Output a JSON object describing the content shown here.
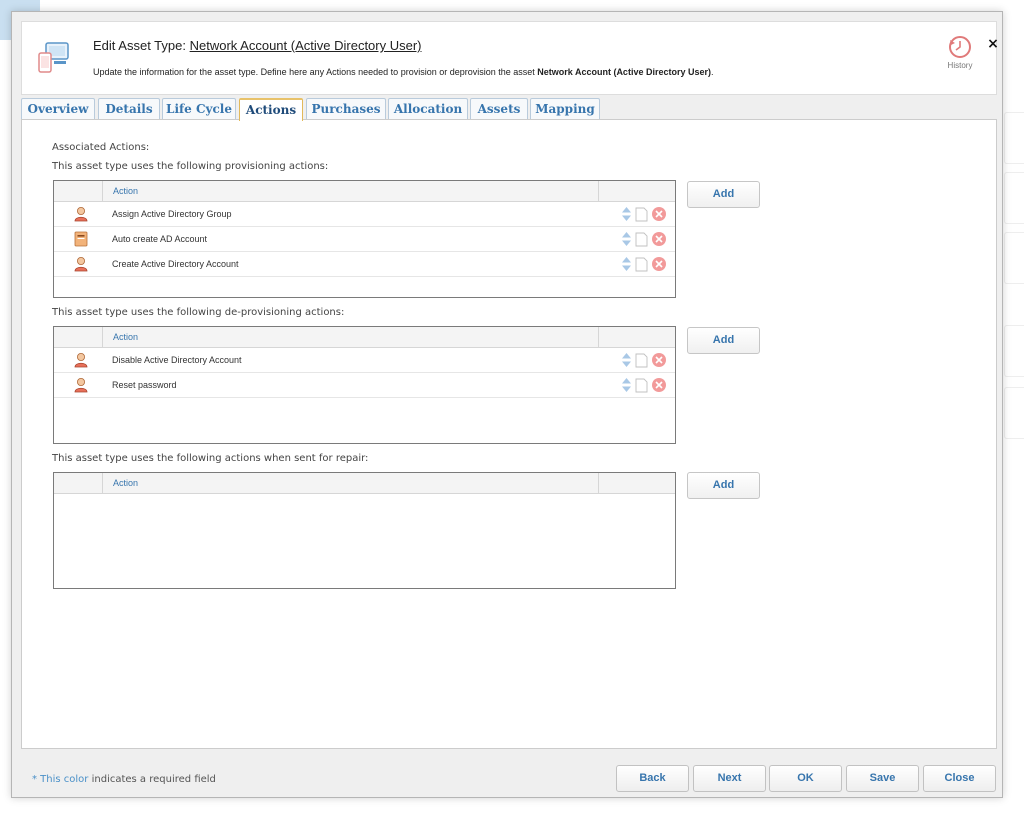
{
  "header": {
    "title_label": "Edit Asset Type:",
    "title_name": "Network Account (Active Directory User)",
    "desc_prefix": "Update the information for the asset type. Define here any Actions needed to provision or deprovision the asset ",
    "desc_asset": "Network Account (Active Directory User)",
    "desc_suffix": ".",
    "history_label": "History",
    "close_label": "×"
  },
  "tabs": [
    {
      "label": "Overview",
      "active": false
    },
    {
      "label": "Details",
      "active": false
    },
    {
      "label": "Life Cycle",
      "active": false
    },
    {
      "label": "Actions",
      "active": true
    },
    {
      "label": "Purchases",
      "active": false
    },
    {
      "label": "Allocation",
      "active": false
    },
    {
      "label": "Assets",
      "active": false
    },
    {
      "label": "Mapping",
      "active": false
    }
  ],
  "content": {
    "associated_label": "Associated Actions:",
    "column_action": "Action",
    "add_label": "Add",
    "provisioning": {
      "label": "This asset type uses the following provisioning actions:",
      "rows": [
        {
          "icon": "person-icon",
          "text": "Assign Active Directory Group"
        },
        {
          "icon": "book-icon",
          "text": "Auto create AD Account"
        },
        {
          "icon": "person-icon",
          "text": "Create Active Directory Account"
        }
      ]
    },
    "deprovisioning": {
      "label": "This asset type uses the following de-provisioning actions:",
      "rows": [
        {
          "icon": "person-icon",
          "text": "Disable Active Directory Account"
        },
        {
          "icon": "person-icon",
          "text": "Reset password"
        }
      ]
    },
    "repair": {
      "label": "This asset type uses the following actions when sent for repair:",
      "rows": []
    }
  },
  "footer": {
    "legend_colored": "* This color",
    "legend_rest": " indicates a required field",
    "buttons": [
      "Back",
      "Next",
      "OK",
      "Save",
      "Close"
    ]
  },
  "colors": {
    "accent": "#3775ad",
    "active_tab_border": "#e8c26a",
    "required": "#4a90c8",
    "delete": "#f29a9a"
  }
}
